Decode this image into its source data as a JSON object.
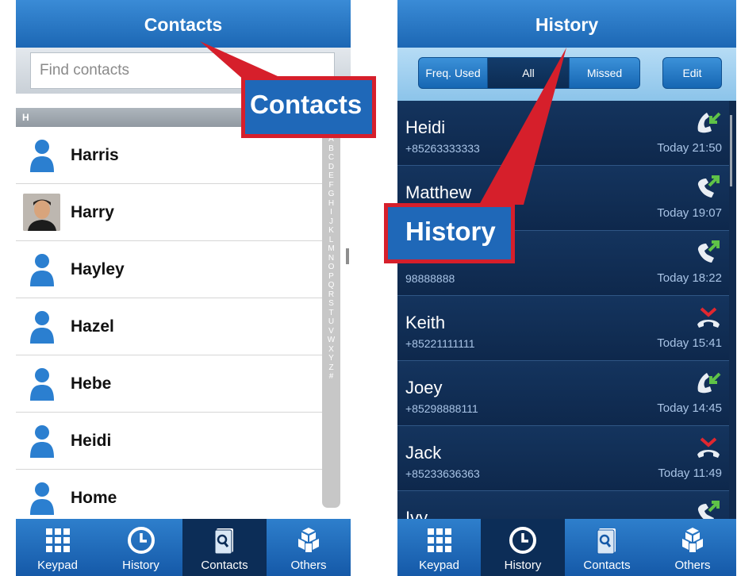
{
  "contacts_screen": {
    "title": "Contacts",
    "search_placeholder": "Find contacts",
    "section_letter": "H",
    "contacts": [
      {
        "name": "Harris",
        "avatar": "person-icon"
      },
      {
        "name": "Harry",
        "avatar": "photo"
      },
      {
        "name": "Hayley",
        "avatar": "person-icon"
      },
      {
        "name": "Hazel",
        "avatar": "person-icon"
      },
      {
        "name": "Hebe",
        "avatar": "person-icon"
      },
      {
        "name": "Heidi",
        "avatar": "person-icon"
      },
      {
        "name": "Home",
        "avatar": "person-icon"
      }
    ],
    "alpha_index": [
      "A",
      "B",
      "C",
      "D",
      "E",
      "F",
      "G",
      "H",
      "I",
      "J",
      "K",
      "L",
      "M",
      "N",
      "O",
      "P",
      "Q",
      "R",
      "S",
      "T",
      "U",
      "V",
      "W",
      "X",
      "Y",
      "Z",
      "#"
    ],
    "tabs": [
      {
        "label": "Keypad",
        "icon": "keypad-icon"
      },
      {
        "label": "History",
        "icon": "clock-icon"
      },
      {
        "label": "Contacts",
        "icon": "contacts-book-icon",
        "active": true
      },
      {
        "label": "Others",
        "icon": "others-icon"
      }
    ]
  },
  "history_screen": {
    "title": "History",
    "filters": {
      "freq_used": "Freq. Used",
      "all": "All",
      "missed": "Missed",
      "edit": "Edit"
    },
    "calls": [
      {
        "name": "Heidi",
        "number": "+85263333333",
        "time": "Today 21:50",
        "type": "incoming"
      },
      {
        "name": "Matthew",
        "number": "",
        "time": "Today 19:07",
        "type": "outgoing"
      },
      {
        "name": "",
        "number": "98888888",
        "time": "Today 18:22",
        "type": "outgoing"
      },
      {
        "name": "Keith",
        "number": "+85221111111",
        "time": "Today 15:41",
        "type": "missed"
      },
      {
        "name": "Joey",
        "number": "+85298888111",
        "time": "Today 14:45",
        "type": "incoming"
      },
      {
        "name": "Jack",
        "number": "+85233636363",
        "time": "Today 11:49",
        "type": "missed"
      },
      {
        "name": "Ivy",
        "number": "",
        "time": "",
        "type": "outgoing"
      }
    ],
    "tabs": [
      {
        "label": "Keypad",
        "icon": "keypad-icon"
      },
      {
        "label": "History",
        "icon": "clock-icon",
        "active": true
      },
      {
        "label": "Contacts",
        "icon": "contacts-book-icon"
      },
      {
        "label": "Others",
        "icon": "others-icon"
      }
    ]
  },
  "annotations": {
    "contacts_label": "Contacts",
    "history_label": "History"
  },
  "colors": {
    "header_blue": "#1c67b4",
    "history_bg": "#102a4e",
    "callout_red": "#d61f2b",
    "incoming_green": "#5fc247",
    "missed_red": "#e0272f"
  }
}
